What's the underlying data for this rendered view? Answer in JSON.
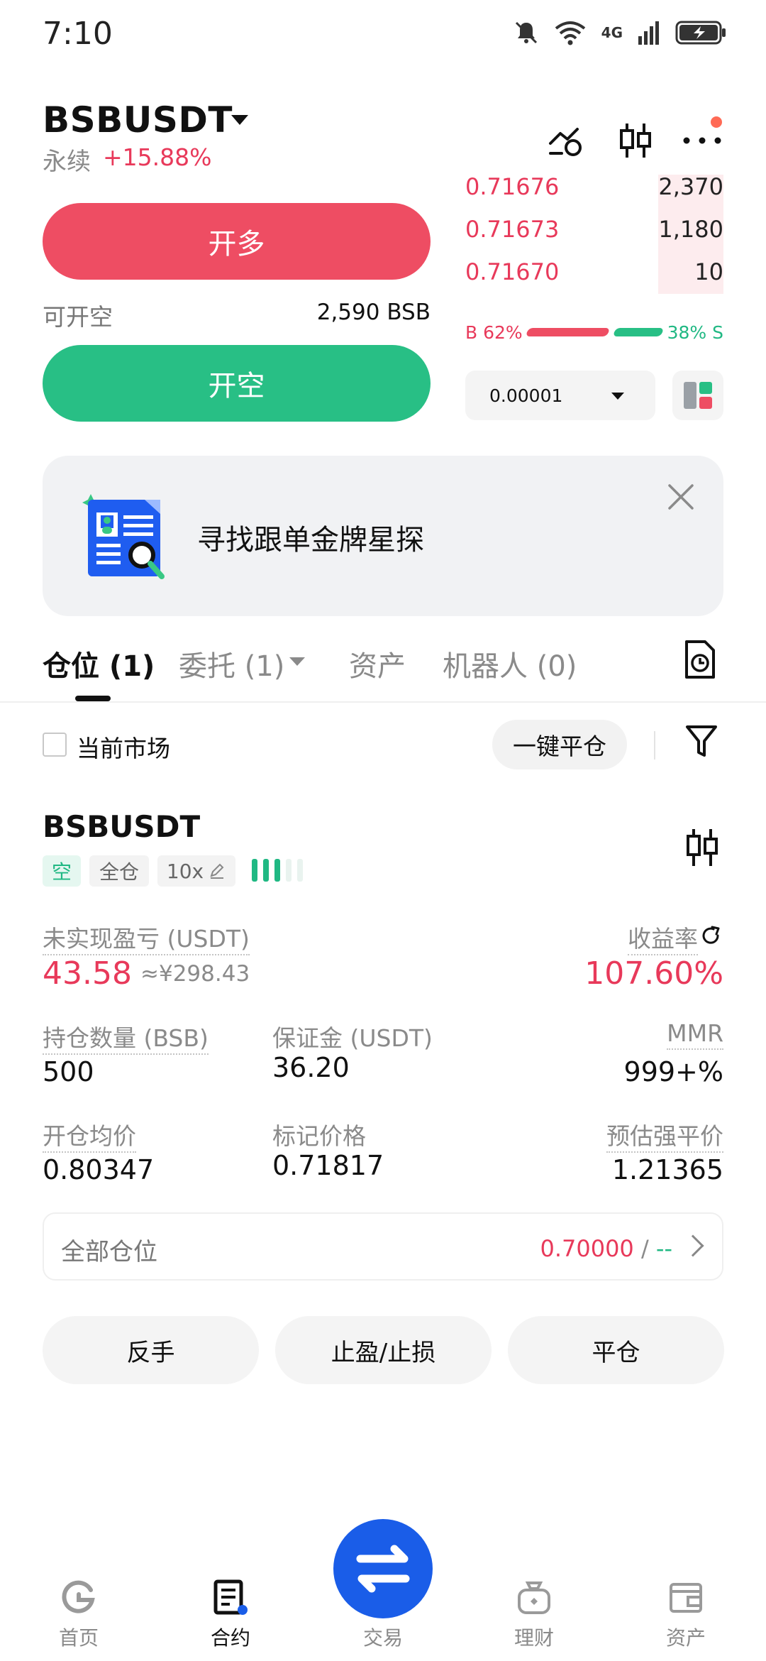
{
  "status_bar": {
    "time": "7:10",
    "network": "4G"
  },
  "header": {
    "pair": "BSBUSDT",
    "contract_type": "永续",
    "change": "+15.88%"
  },
  "order_book": {
    "rows": [
      {
        "price": "0.71676",
        "qty": "2,370"
      },
      {
        "price": "0.71673",
        "qty": "1,180"
      },
      {
        "price": "0.71670",
        "qty": "10"
      }
    ],
    "buy_ratio": "B 62%",
    "sell_ratio": "38% S",
    "buy_fraction": 0.62,
    "precision": "0.00001"
  },
  "order_panel": {
    "long_label": "开多",
    "short_avail_label": "可开空",
    "short_avail_value": "2,590 BSB",
    "short_label": "开空"
  },
  "banner": {
    "text": "寻找跟单金牌星探"
  },
  "tabs": [
    {
      "label": "仓位 (1)"
    },
    {
      "label": "委托 (1)"
    },
    {
      "label": "资产"
    },
    {
      "label": "机器人 (0)"
    }
  ],
  "filter": {
    "current_market_label": "当前市场",
    "close_all_label": "一键平仓"
  },
  "position": {
    "symbol": "BSBUSDT",
    "side_tag": "空",
    "margin_mode_tag": "全仓",
    "leverage_tag": "10x",
    "risk_level": 3,
    "unrealized_label": "未实现盈亏 (USDT)",
    "unrealized_value": "43.58",
    "unrealized_cny": "≈¥298.43",
    "roe_label": "收益率",
    "roe_value": "107.60%",
    "size_label": "持仓数量 (BSB)",
    "size_value": "500",
    "margin_label": "保证金 (USDT)",
    "margin_value": "36.20",
    "mmr_label": "MMR",
    "mmr_value": "999+%",
    "entry_label": "开仓均价",
    "entry_value": "0.80347",
    "mark_label": "标记价格",
    "mark_value": "0.71817",
    "liq_label": "预估强平价",
    "liq_value": "1.21365"
  },
  "summary": {
    "label": "全部仓位",
    "value_a": "0.70000",
    "sep": " / ",
    "value_b": "--"
  },
  "actions": {
    "reverse": "反手",
    "tpsl": "止盈/止损",
    "close": "平仓"
  },
  "bottom_nav": {
    "home": "首页",
    "contract": "合约",
    "trade": "交易",
    "finance": "理财",
    "assets": "资产"
  },
  "colors": {
    "red": "#e8395a",
    "green": "#20b883",
    "blue": "#1a5de8",
    "orange": "#f39a43"
  }
}
